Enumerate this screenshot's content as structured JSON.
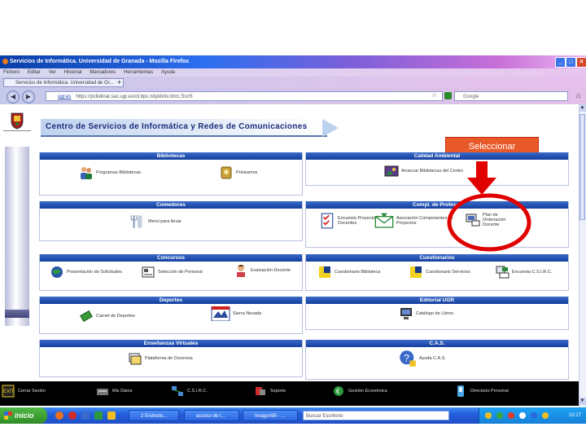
{
  "window": {
    "title": "Servicios de Informática. Universidad de Granada - Mozilla Firefox",
    "minimize": "_",
    "maximize": "□",
    "close": "×"
  },
  "menu": [
    "Fichero",
    "Editar",
    "Ver",
    "Historial",
    "Marcadores",
    "Herramientas",
    "Ayuda"
  ],
  "tab": {
    "label": "Servicios de Informática. Universidad de Gr...",
    "new_tab": "+"
  },
  "nav": {
    "back": "◀",
    "forward": "▶",
    "url_site": "ugr.es",
    "url": "https://pcliidinat.sac.ugr.es/cli.bpc.nitykb/ini.bhrc.SsnS",
    "search_placeholder": "Google"
  },
  "banner": {
    "text": "Centro de Servicios de Informática y Redes de Comunicaciones"
  },
  "callout": {
    "text": "Seleccionar"
  },
  "sections": {
    "bibliotecas": {
      "title": "Bibliotecas",
      "items": [
        {
          "label": "Programas Bibliotecas",
          "icon": "people-icon"
        },
        {
          "label": "Préstamos",
          "icon": "address-book-icon"
        }
      ]
    },
    "calidad": {
      "title": "Calidad Ambiental",
      "items": [
        {
          "label": "Arrancar Bibliotecas del Centro",
          "icon": "photo-icon"
        }
      ]
    },
    "comedores": {
      "title": "Comedores",
      "items": [
        {
          "label": "Menú para llevar",
          "icon": "cutlery-icon"
        }
      ]
    },
    "compl": {
      "title": "Compl. de Profesor",
      "items": [
        {
          "label": "Encuesta Proyectos Docentes",
          "icon": "checklist-icon"
        },
        {
          "label": "Asociación Componentes de Proyectos",
          "icon": "envelope-icon"
        },
        {
          "label": "Plan de Ordenación Docente",
          "icon": "computer-icon"
        }
      ]
    },
    "concursos": {
      "title": "Concursos",
      "items": [
        {
          "label": "Presentación de Solicitudes",
          "icon": "globe-icon"
        },
        {
          "label": "Selección de Personal",
          "icon": "form-icon"
        },
        {
          "label": "Evaluación Docente",
          "icon": "student-icon"
        }
      ]
    },
    "cuestionarios": {
      "title": "Cuestionarios",
      "items": [
        {
          "label": "Cuestionario Biblioteca",
          "icon": "bib-icon"
        },
        {
          "label": "Cuestionario Servicios",
          "icon": "serv-icon"
        },
        {
          "label": "Encuesta C.S.I.R.C.",
          "icon": "pc-icon"
        }
      ]
    },
    "deportes": {
      "title": "Deportes",
      "items": [
        {
          "label": "Carnet de Deportes",
          "icon": "money-icon"
        },
        {
          "label": "Sierra Nevada",
          "icon": "sierra-icon"
        }
      ]
    },
    "editorial": {
      "title": "Editorial UGR",
      "items": [
        {
          "label": "Catálogo de Libros",
          "icon": "monitor-icon"
        }
      ]
    },
    "ensenanzas": {
      "title": "Enseñanzas Virtuales",
      "items": [
        {
          "label": "Plataforma de Docencia",
          "icon": "docs-icon"
        }
      ]
    },
    "cas": {
      "title": "C.A.S.",
      "items": [
        {
          "label": "Ayuda C.A.S.",
          "icon": "help-icon"
        }
      ]
    }
  },
  "bottom_links": [
    {
      "label": "Cerrar Sesión",
      "icon": "exit-icon"
    },
    {
      "label": "Mis Datos",
      "icon": "keyboard-icon"
    },
    {
      "label": "C.S.I.R.C.",
      "icon": "network-icon"
    },
    {
      "label": "Soporte",
      "icon": "support-icon"
    },
    {
      "label": "Gestión Económica",
      "icon": "eco-icon"
    },
    {
      "label": "Directorio Personal",
      "icon": "phone-icon"
    }
  ],
  "taskbar": {
    "start": "inicio",
    "buttons": [
      "2 Endnote...",
      "acceso de l...",
      "Imagen98 - ..."
    ],
    "desktop_search": "Buscar Escritorio",
    "clock": "10:17"
  },
  "colors": {
    "section_header": "#133f9e",
    "callout_fill": "#e95a2a",
    "highlight_circle": "#e00000",
    "arrow": "#e00000"
  }
}
